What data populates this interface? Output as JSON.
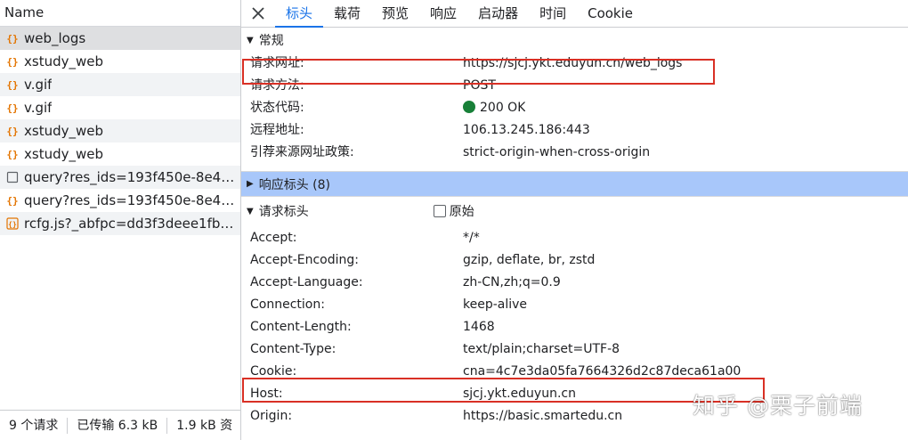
{
  "list": {
    "header": "Name",
    "requests": [
      {
        "name": "web_logs",
        "icon": "json-icon"
      },
      {
        "name": "xstudy_web",
        "icon": "json-icon"
      },
      {
        "name": "v.gif",
        "icon": "json-icon"
      },
      {
        "name": "v.gif",
        "icon": "json-icon"
      },
      {
        "name": "xstudy_web",
        "icon": "json-icon"
      },
      {
        "name": "xstudy_web",
        "icon": "json-icon"
      },
      {
        "name": "query?res_ids=193f450e-8e40-...",
        "icon": "document-icon"
      },
      {
        "name": "query?res_ids=193f450e-8e40-...",
        "icon": "json-icon"
      },
      {
        "name": "rcfg.js?_abfpc=dd3f3deee1fb8...",
        "icon": "script-icon"
      }
    ],
    "status": {
      "requests": "9 个请求",
      "transferred": "已传输 6.3 kB",
      "resources": "1.9 kB 资"
    }
  },
  "tabs": [
    "标头",
    "载荷",
    "预览",
    "响应",
    "启动器",
    "时间",
    "Cookie"
  ],
  "general": {
    "title": "常规",
    "rows": [
      {
        "key": "请求网址:",
        "value": "https://sjcj.ykt.eduyun.cn/web_logs"
      },
      {
        "key": "请求方法:",
        "value": "POST"
      },
      {
        "key": "状态代码:",
        "value": "200 OK"
      },
      {
        "key": "远程地址:",
        "value": "106.13.245.186:443"
      },
      {
        "key": "引荐来源网址政策:",
        "value": "strict-origin-when-cross-origin"
      }
    ]
  },
  "response_headers": {
    "title": "响应标头 (8)"
  },
  "request_headers": {
    "title": "请求标头",
    "raw_label": "原始",
    "rows": [
      {
        "key": "Accept:",
        "value": "*/*"
      },
      {
        "key": "Accept-Encoding:",
        "value": "gzip, deflate, br, zstd"
      },
      {
        "key": "Accept-Language:",
        "value": "zh-CN,zh;q=0.9"
      },
      {
        "key": "Connection:",
        "value": "keep-alive"
      },
      {
        "key": "Content-Length:",
        "value": "1468"
      },
      {
        "key": "Content-Type:",
        "value": "text/plain;charset=UTF-8"
      },
      {
        "key": "Cookie:",
        "value": "cna=4c7e3da05fa7664326d2c87deca61a00"
      },
      {
        "key": "Host:",
        "value": "sjcj.ykt.eduyun.cn"
      },
      {
        "key": "Origin:",
        "value": "https://basic.smartedu.cn"
      }
    ]
  },
  "colors": {
    "accent": "#1a73e8",
    "status_ok": "#188038",
    "highlight_box": "#d93025",
    "section_highlight": "#a8c7fa"
  },
  "watermark": "知乎 @栗子前端"
}
